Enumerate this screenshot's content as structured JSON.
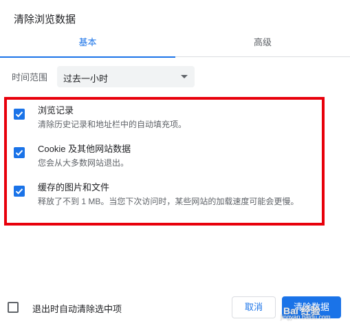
{
  "dialog": {
    "title": "清除浏览数据"
  },
  "tabs": [
    {
      "label": "基本",
      "active": true
    },
    {
      "label": "高级",
      "active": false
    }
  ],
  "time_range": {
    "label": "时间范围",
    "value": "过去一小时"
  },
  "options": [
    {
      "title": "浏览记录",
      "desc": "清除历史记录和地址栏中的自动填充项。",
      "checked": true
    },
    {
      "title": "Cookie 及其他网站数据",
      "desc": "您会从大多数网站退出。",
      "checked": true
    },
    {
      "title": "缓存的图片和文件",
      "desc": "释放了不到 1 MB。当您下次访问时，某些网站的加载速度可能会更慢。",
      "checked": true
    }
  ],
  "footer": {
    "auto_clear_label": "退出时自动清除选中项",
    "auto_clear_checked": false,
    "cancel_label": "取消",
    "clear_label": "清除数据"
  },
  "watermark": {
    "text": "Bai 经验",
    "url": "jingyan.baidu.com"
  },
  "colors": {
    "accent": "#1a73e8",
    "highlight": "#e8000b"
  }
}
